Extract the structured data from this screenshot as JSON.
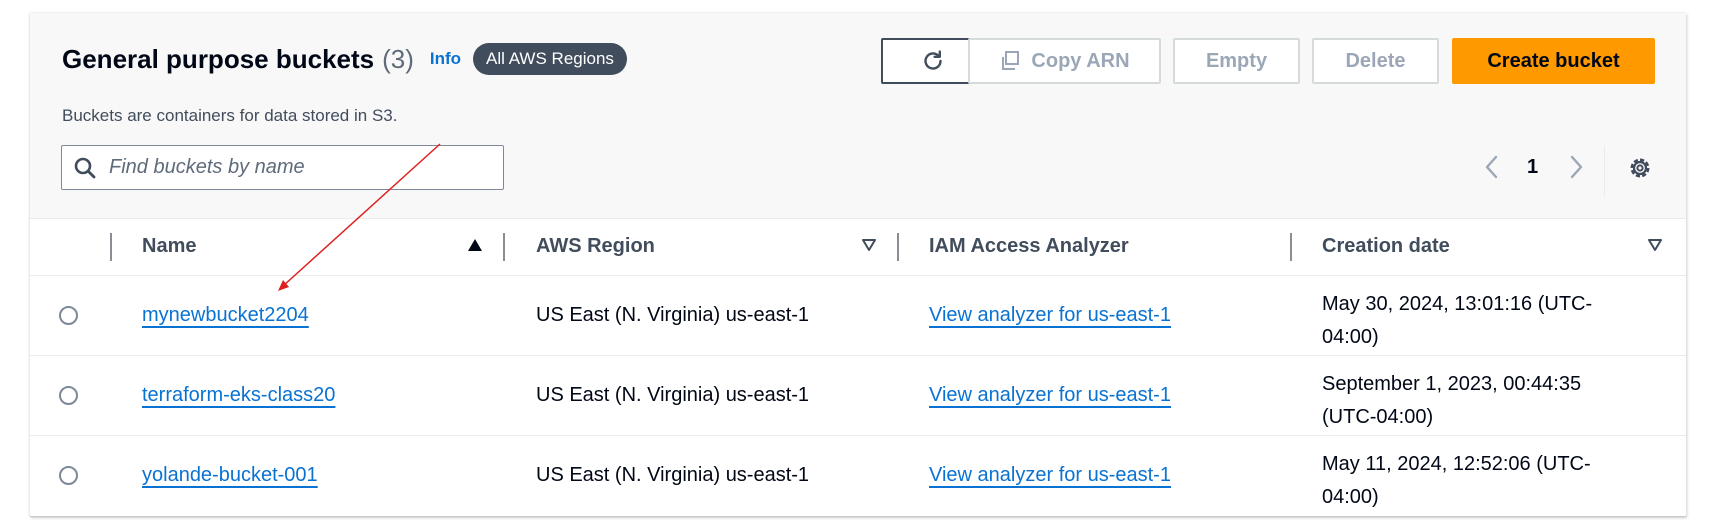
{
  "header": {
    "title": "General purpose buckets",
    "count": "(3)",
    "info": "Info",
    "region_filter": "All AWS Regions",
    "subtitle": "Buckets are containers for data stored in S3."
  },
  "actions": {
    "copy_arn": "Copy ARN",
    "empty": "Empty",
    "delete": "Delete",
    "create": "Create bucket"
  },
  "search": {
    "placeholder": "Find buckets by name",
    "value": ""
  },
  "pagination": {
    "page": "1"
  },
  "table": {
    "columns": [
      "Name",
      "AWS Region",
      "IAM Access Analyzer",
      "Creation date"
    ],
    "sort": {
      "column": "Name",
      "direction": "ascending"
    },
    "rows": [
      {
        "name": "mynewbucket2204",
        "region": "US East (N. Virginia) us-east-1",
        "analyzer": "View analyzer for us-east-1",
        "date_line1": "May 30, 2024, 13:01:16 (UTC-",
        "date_line2": "04:00)"
      },
      {
        "name": "terraform-eks-class20",
        "region": "US East (N. Virginia) us-east-1",
        "analyzer": "View analyzer for us-east-1",
        "date_line1": "September 1, 2023, 00:44:35",
        "date_line2": "(UTC-04:00)"
      },
      {
        "name": "yolande-bucket-001",
        "region": "US East (N. Virginia) us-east-1",
        "analyzer": "View analyzer for us-east-1",
        "date_line1": "May 11, 2024, 12:52:06 (UTC-",
        "date_line2": "04:00)"
      }
    ]
  },
  "colors": {
    "primary_button": "#ff9900",
    "link": "#0972d3",
    "badge": "#414d5c",
    "annotation_arrow": "#e02020"
  },
  "icons": [
    "refresh-icon",
    "copy-icon",
    "search-icon",
    "chevron-left-icon",
    "chevron-right-icon",
    "settings-gear-icon",
    "sort-ascending-icon",
    "sort-descending-icon"
  ]
}
